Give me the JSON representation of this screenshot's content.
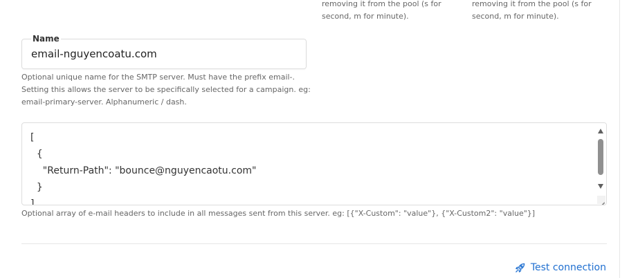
{
  "colors": {
    "link": "#1f6fd0",
    "help_text": "#666666",
    "border": "#dddddd"
  },
  "top_help": {
    "col1": "removing it from the pool (s for second, m for minute).",
    "col2": "removing it from the pool (s for second, m for minute)."
  },
  "name_field": {
    "label": "Name",
    "value": "email-nguyencoatu.com",
    "help": "Optional unique name for the SMTP server. Must have the prefix email-. Setting this allows the server to be specifically selected for a campaign. eg: email-primary-server. Alphanumeric / dash."
  },
  "headers_field": {
    "value": "[\n  {\n    \"Return-Path\": \"bounce@nguyencaotu.com\"\n  }\n]",
    "help": "Optional array of e-mail headers to include in all messages sent from this server. eg: [{\"X-Custom\": \"value\"}, {\"X-Custom2\": \"value\"}]"
  },
  "actions": {
    "test_connection_label": "Test connection",
    "test_connection_icon": "rocket-icon"
  }
}
